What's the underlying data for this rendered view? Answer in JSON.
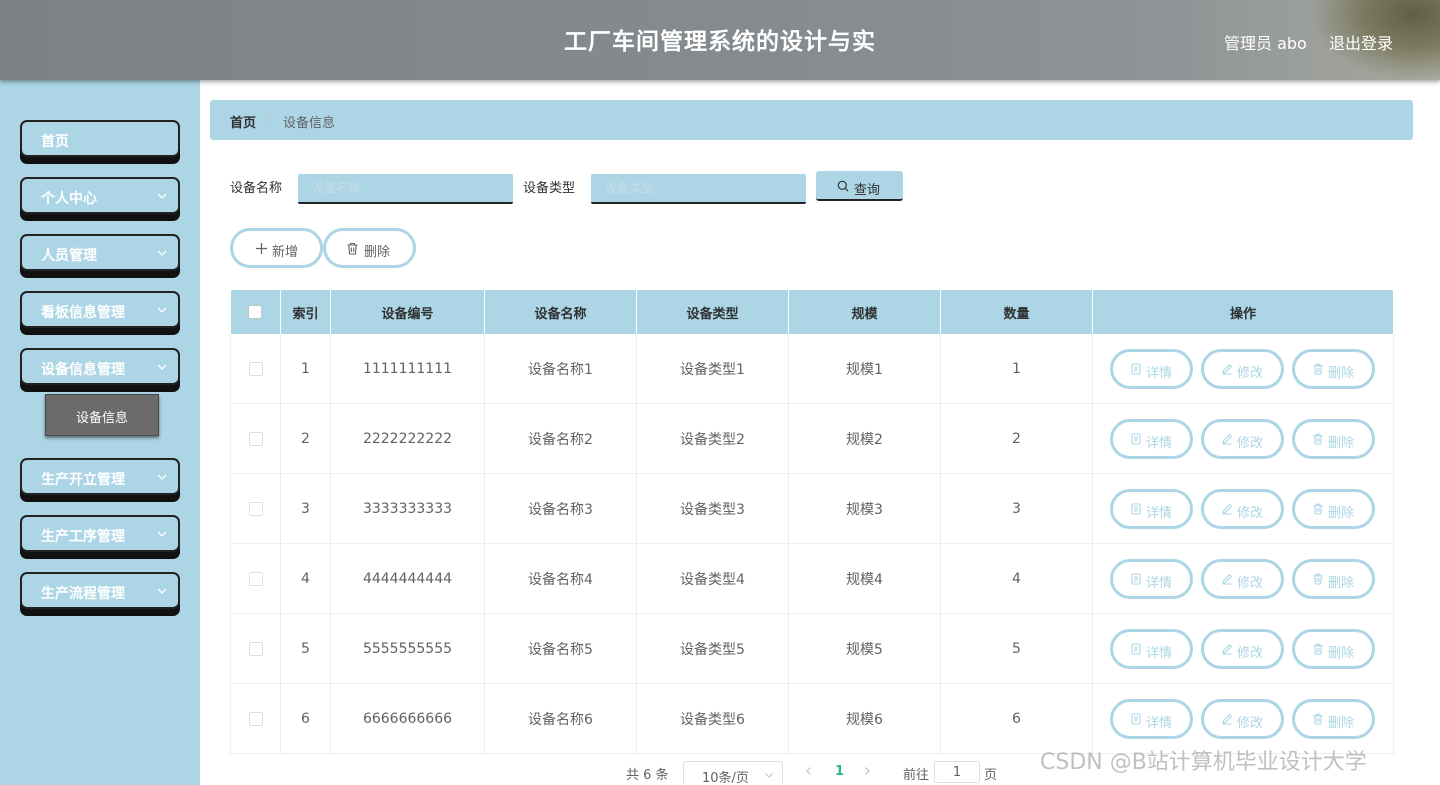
{
  "header": {
    "title": "工厂车间管理系统的设计与实",
    "user": "管理员 abo",
    "logout": "退出登录"
  },
  "sidebar": {
    "items": [
      {
        "label": "首页"
      },
      {
        "label": "个人中心"
      },
      {
        "label": "人员管理"
      },
      {
        "label": "看板信息管理"
      },
      {
        "label": "设备信息管理"
      },
      {
        "label": "生产开立管理"
      },
      {
        "label": "生产工序管理"
      },
      {
        "label": "生产流程管理"
      }
    ],
    "active_sub": "设备信息"
  },
  "breadcrumb": {
    "home": "首页",
    "separator": "/",
    "current": "设备信息"
  },
  "search": {
    "name_label": "设备名称",
    "name_placeholder": "设备名称",
    "name_value": "",
    "type_label": "设备类型",
    "type_placeholder": "设备类型",
    "type_value": "",
    "query_label": "查询"
  },
  "actions": {
    "add_label": "新增",
    "delete_label": "删除"
  },
  "table": {
    "columns": [
      "索引",
      "设备编号",
      "设备名称",
      "设备类型",
      "规模",
      "数量",
      "操作"
    ],
    "op_labels": {
      "detail": "详情",
      "edit": "修改",
      "delete": "删除"
    },
    "rows": [
      {
        "index": "1",
        "code": "1111111111",
        "name": "设备名称1",
        "type": "设备类型1",
        "scale": "规模1",
        "qty": "1"
      },
      {
        "index": "2",
        "code": "2222222222",
        "name": "设备名称2",
        "type": "设备类型2",
        "scale": "规模2",
        "qty": "2"
      },
      {
        "index": "3",
        "code": "3333333333",
        "name": "设备名称3",
        "type": "设备类型3",
        "scale": "规模3",
        "qty": "3"
      },
      {
        "index": "4",
        "code": "4444444444",
        "name": "设备名称4",
        "type": "设备类型4",
        "scale": "规模4",
        "qty": "4"
      },
      {
        "index": "5",
        "code": "5555555555",
        "name": "设备名称5",
        "type": "设备类型5",
        "scale": "规模5",
        "qty": "5"
      },
      {
        "index": "6",
        "code": "6666666666",
        "name": "设备名称6",
        "type": "设备类型6",
        "scale": "规模6",
        "qty": "6"
      }
    ]
  },
  "pagination": {
    "total": "共 6 条",
    "page_size": "10条/页",
    "current_page": "1",
    "goto_label": "前往",
    "goto_value": "1",
    "page_unit": "页"
  },
  "watermark": "CSDN @B站计算机毕业设计大学",
  "colors": {
    "accent": "#acd6e5",
    "header": "#858b8f",
    "active_sub": "#6b6b6b"
  }
}
